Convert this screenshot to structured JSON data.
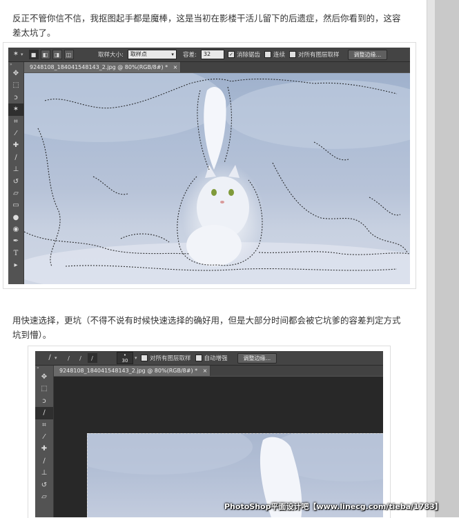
{
  "article": {
    "paragraph_1": "反正不管你信不信，我抠图起手都是魔棒，这是当初在影楼干活儿留下的后遗症，然后你看到的，这容差太坑了。",
    "paragraph_2": "用快速选择，更坑（不得不说有时候快速选择的确好用，但是大部分时间都会被它坑爹的容差判定方式坑到懵）。"
  },
  "screenshot_1": {
    "options_bar": {
      "sample_size_label": "取样大小:",
      "sample_size_value": "取样点",
      "tolerance_label": "容差:",
      "tolerance_value": "32",
      "anti_alias_label": "消除锯齿",
      "anti_alias_checked": "✓",
      "contiguous_label": "连续",
      "sample_all_layers_label": "对所有图层取样",
      "refine_edge_button": "调整边缘..."
    },
    "doc_tab": "9248108_184041548143_2.jpg @ 80%(RGB/8#) *",
    "doc_tab_close": "×",
    "toolbox_collapse": "»"
  },
  "screenshot_2": {
    "options_bar": {
      "brush_size": "30",
      "sample_all_layers_label": "对所有图层取样",
      "auto_enhance_label": "自动增强",
      "refine_edge_button": "调整边缘..."
    },
    "doc_tab": "9248108_184041548143_2.jpg @ 80%(RGB/8#) *",
    "doc_tab_close": "×",
    "toolbox_collapse": "»"
  },
  "toolbox_icons": [
    "move-icon",
    "marquee-icon",
    "lasso-icon",
    "magic-wand-icon",
    "crop-icon",
    "eyedropper-icon",
    "healing-brush-icon",
    "brush-icon",
    "clone-stamp-icon",
    "history-brush-icon",
    "eraser-icon",
    "gradient-icon",
    "blur-icon",
    "dodge-icon",
    "pen-icon",
    "type-icon",
    "path-select-icon"
  ],
  "watermark": "PhotoShop平面设计吧【www.linecg.com/tieba/1783】"
}
